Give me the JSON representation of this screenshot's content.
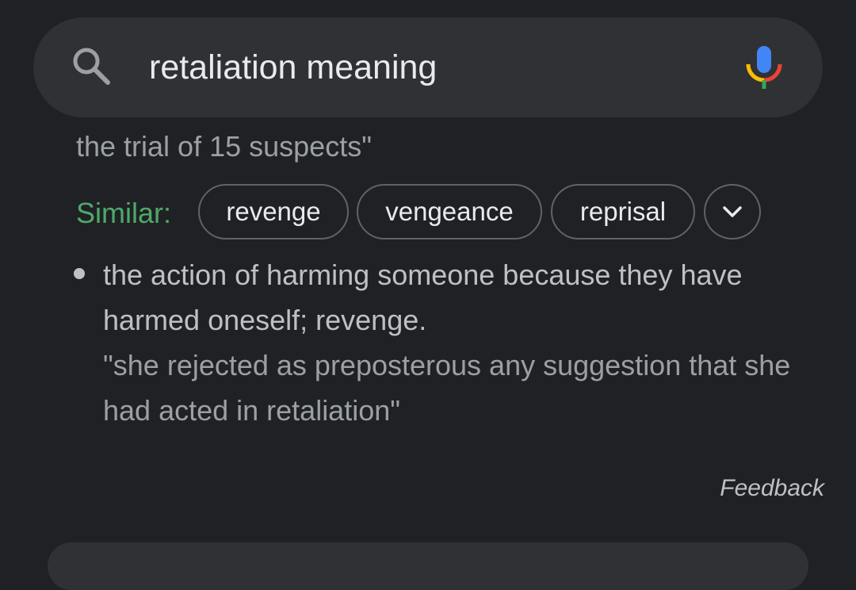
{
  "search": {
    "query": "retaliation meaning",
    "search_icon": "search-icon",
    "mic_icon": "microphone-icon"
  },
  "result": {
    "snippet_tail": "the trial of 15 suspects\"",
    "similar_label": "Similar:",
    "similar_chips": [
      "revenge",
      "vengeance",
      "reprisal"
    ],
    "expand_icon": "chevron-down-icon",
    "definition": "the action of harming someone because they have harmed oneself; revenge.",
    "example": "\"she rejected as preposterous any suggestion that she had acted in retaliation\"",
    "feedback_label": "Feedback"
  },
  "colors": {
    "background": "#202124",
    "surface": "#303134",
    "similar_green": "#4ea96b",
    "text_primary": "#e8eaed",
    "text_secondary": "#9aa0a6"
  }
}
